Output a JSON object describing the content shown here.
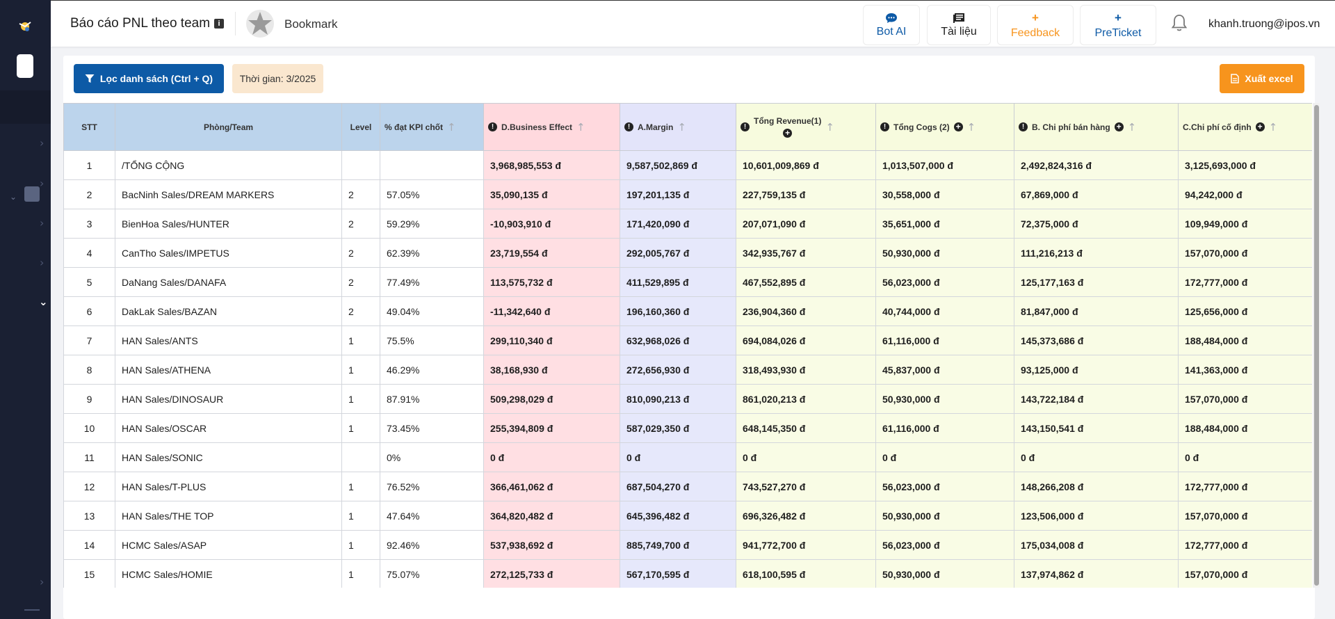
{
  "header": {
    "title": "Báo cáo PNL theo team",
    "bookmark": "Bookmark",
    "buttons": {
      "bot_ai": "Bot AI",
      "tai_lieu": "Tài liệu",
      "feedback": "Feedback",
      "preticket": "PreTicket"
    },
    "feedback_plus": "+",
    "preticket_plus": "+",
    "user_email": "khanh.truong@ipos.vn"
  },
  "toolbar": {
    "filter_label": "Lọc danh sách (Ctrl + Q)",
    "time_label": "Thời gian: 3/2025",
    "export_label": "Xuất excel"
  },
  "colors": {
    "primary": "#0d5aa6",
    "orange": "#f7941d",
    "sidebar": "#1a2033"
  },
  "table": {
    "columns": {
      "stt": "STT",
      "team": "Phòng/Team",
      "level": "Level",
      "kpi": "% đạt KPI chốt",
      "business_effect": "D.Business Effect",
      "margin": "A.Margin",
      "revenue": "Tổng Revenue(1)",
      "cogs": "Tổng Cogs (2)",
      "sales_cost": "B. Chi phí bán hàng",
      "fixed_cost": "C.Chi phí cố định"
    },
    "rows": [
      {
        "stt": "1",
        "team": "/TỔNG CỘNG",
        "level": "",
        "kpi": "",
        "be": "3,968,985,553 đ",
        "margin": "9,587,502,869 đ",
        "revenue": "10,601,009,869 đ",
        "cogs": "1,013,507,000 đ",
        "sales": "2,492,824,316 đ",
        "fixed": "3,125,693,000 đ"
      },
      {
        "stt": "2",
        "team": "BacNinh Sales/DREAM MARKERS",
        "level": "2",
        "kpi": "57.05%",
        "be": "35,090,135 đ",
        "margin": "197,201,135 đ",
        "revenue": "227,759,135 đ",
        "cogs": "30,558,000 đ",
        "sales": "67,869,000 đ",
        "fixed": "94,242,000 đ"
      },
      {
        "stt": "3",
        "team": "BienHoa Sales/HUNTER",
        "level": "2",
        "kpi": "59.29%",
        "be": "-10,903,910 đ",
        "margin": "171,420,090 đ",
        "revenue": "207,071,090 đ",
        "cogs": "35,651,000 đ",
        "sales": "72,375,000 đ",
        "fixed": "109,949,000 đ"
      },
      {
        "stt": "4",
        "team": "CanTho Sales/IMPETUS",
        "level": "2",
        "kpi": "62.39%",
        "be": "23,719,554 đ",
        "margin": "292,005,767 đ",
        "revenue": "342,935,767 đ",
        "cogs": "50,930,000 đ",
        "sales": "111,216,213 đ",
        "fixed": "157,070,000 đ"
      },
      {
        "stt": "5",
        "team": "DaNang Sales/DANAFA",
        "level": "2",
        "kpi": "77.49%",
        "be": "113,575,732 đ",
        "margin": "411,529,895 đ",
        "revenue": "467,552,895 đ",
        "cogs": "56,023,000 đ",
        "sales": "125,177,163 đ",
        "fixed": "172,777,000 đ"
      },
      {
        "stt": "6",
        "team": "DakLak Sales/BAZAN",
        "level": "2",
        "kpi": "49.04%",
        "be": "-11,342,640 đ",
        "margin": "196,160,360 đ",
        "revenue": "236,904,360 đ",
        "cogs": "40,744,000 đ",
        "sales": "81,847,000 đ",
        "fixed": "125,656,000 đ"
      },
      {
        "stt": "7",
        "team": "HAN Sales/ANTS",
        "level": "1",
        "kpi": "75.5%",
        "be": "299,110,340 đ",
        "margin": "632,968,026 đ",
        "revenue": "694,084,026 đ",
        "cogs": "61,116,000 đ",
        "sales": "145,373,686 đ",
        "fixed": "188,484,000 đ"
      },
      {
        "stt": "8",
        "team": "HAN Sales/ATHENA",
        "level": "1",
        "kpi": "46.29%",
        "be": "38,168,930 đ",
        "margin": "272,656,930 đ",
        "revenue": "318,493,930 đ",
        "cogs": "45,837,000 đ",
        "sales": "93,125,000 đ",
        "fixed": "141,363,000 đ"
      },
      {
        "stt": "9",
        "team": "HAN Sales/DINOSAUR",
        "level": "1",
        "kpi": "87.91%",
        "be": "509,298,029 đ",
        "margin": "810,090,213 đ",
        "revenue": "861,020,213 đ",
        "cogs": "50,930,000 đ",
        "sales": "143,722,184 đ",
        "fixed": "157,070,000 đ"
      },
      {
        "stt": "10",
        "team": "HAN Sales/OSCAR",
        "level": "1",
        "kpi": "73.45%",
        "be": "255,394,809 đ",
        "margin": "587,029,350 đ",
        "revenue": "648,145,350 đ",
        "cogs": "61,116,000 đ",
        "sales": "143,150,541 đ",
        "fixed": "188,484,000 đ"
      },
      {
        "stt": "11",
        "team": "HAN Sales/SONIC",
        "level": "",
        "kpi": "0%",
        "be": "0 đ",
        "margin": "0 đ",
        "revenue": "0 đ",
        "cogs": "0 đ",
        "sales": "0 đ",
        "fixed": "0 đ"
      },
      {
        "stt": "12",
        "team": "HAN Sales/T-PLUS",
        "level": "1",
        "kpi": "76.52%",
        "be": "366,461,062 đ",
        "margin": "687,504,270 đ",
        "revenue": "743,527,270 đ",
        "cogs": "56,023,000 đ",
        "sales": "148,266,208 đ",
        "fixed": "172,777,000 đ"
      },
      {
        "stt": "13",
        "team": "HAN Sales/THE TOP",
        "level": "1",
        "kpi": "47.64%",
        "be": "364,820,482 đ",
        "margin": "645,396,482 đ",
        "revenue": "696,326,482 đ",
        "cogs": "50,930,000 đ",
        "sales": "123,506,000 đ",
        "fixed": "157,070,000 đ"
      },
      {
        "stt": "14",
        "team": "HCMC Sales/ASAP",
        "level": "1",
        "kpi": "92.46%",
        "be": "537,938,692 đ",
        "margin": "885,749,700 đ",
        "revenue": "941,772,700 đ",
        "cogs": "56,023,000 đ",
        "sales": "175,034,008 đ",
        "fixed": "172,777,000 đ"
      },
      {
        "stt": "15",
        "team": "HCMC Sales/HOMIE",
        "level": "1",
        "kpi": "75.07%",
        "be": "272,125,733 đ",
        "margin": "567,170,595 đ",
        "revenue": "618,100,595 đ",
        "cogs": "50,930,000 đ",
        "sales": "137,974,862 đ",
        "fixed": "157,070,000 đ"
      }
    ]
  }
}
